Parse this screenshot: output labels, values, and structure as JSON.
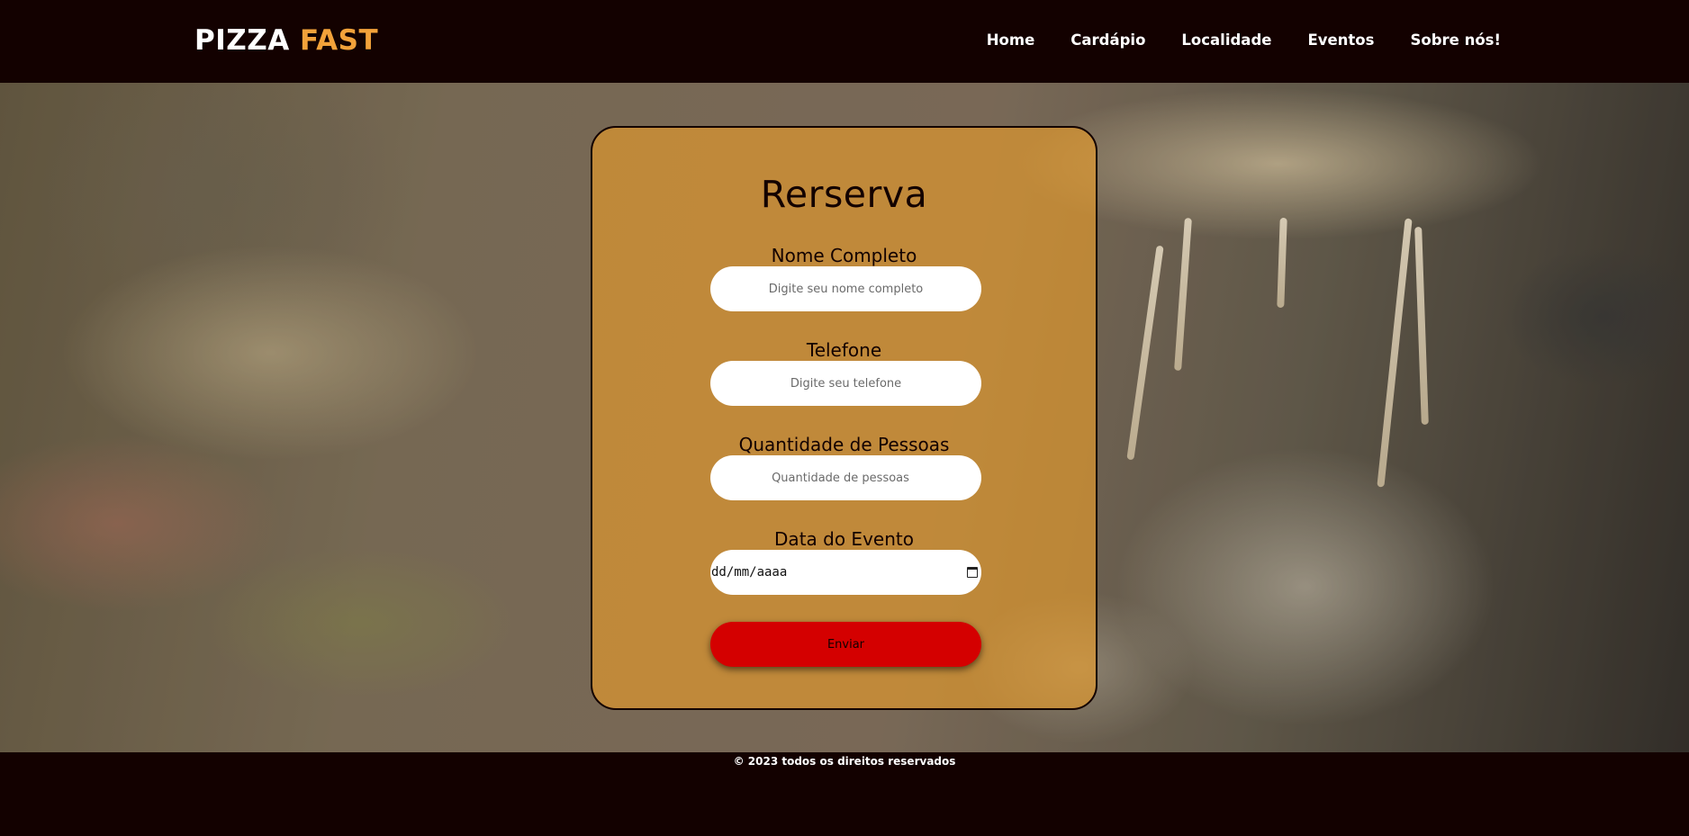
{
  "header": {
    "logo_primary": "PIZZA",
    "logo_accent": "FAST",
    "nav": [
      "Home",
      "Cardápio",
      "Localidade",
      "Eventos",
      "Sobre nós!"
    ]
  },
  "form": {
    "title": "Rerserva",
    "fields": [
      {
        "label": "Nome Completo",
        "placeholder": "Digite seu nome completo"
      },
      {
        "label": "Telefone",
        "placeholder": "Digite seu telefone"
      },
      {
        "label": "Quantidade de Pessoas",
        "placeholder": "Quantidade de pessoas"
      },
      {
        "label": "Data do Evento",
        "placeholder": "dd/mm/aaaa"
      }
    ],
    "submit_label": "Enviar"
  },
  "footer": {
    "text": "© 2023 todos os direitos reservados"
  },
  "colors": {
    "background": "#130100",
    "logo_accent": "#f2a23a",
    "card_tint": "#f0a028",
    "submit_button": "#d40000"
  }
}
